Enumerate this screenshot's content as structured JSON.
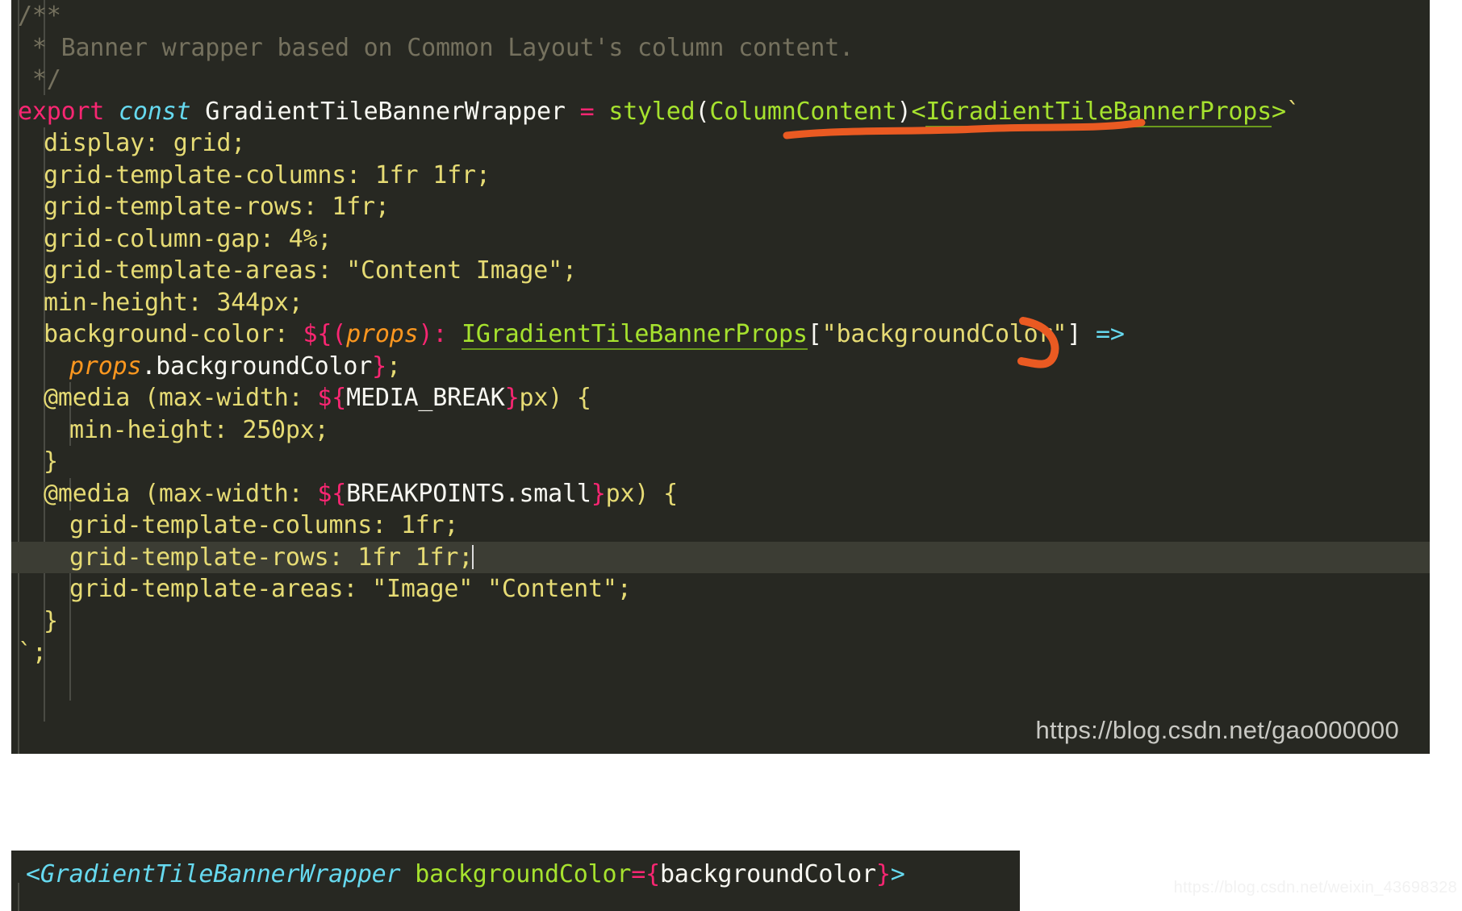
{
  "editor": {
    "theme_background": "#272822",
    "page_background": "#ffffff",
    "highlight_line_background": "#3c3d34",
    "main_block": {
      "lines": [
        {
          "n": 1,
          "indent": 0,
          "tokens": [
            {
              "c": "t-comment",
              "t": "/**"
            }
          ]
        },
        {
          "n": 2,
          "indent": 0,
          "tokens": [
            {
              "c": "t-comment",
              "t": " * Banner wrapper based on Common Layout's column content."
            }
          ]
        },
        {
          "n": 3,
          "indent": 0,
          "tokens": [
            {
              "c": "t-comment",
              "t": " */"
            }
          ]
        },
        {
          "n": 4,
          "indent": 0,
          "tokens": [
            {
              "c": "t-keyword",
              "t": "export "
            },
            {
              "c": "t-storage",
              "t": "const "
            },
            {
              "c": "t-plain",
              "t": "GradientTileBannerWrapper "
            },
            {
              "c": "t-keyword",
              "t": "= "
            },
            {
              "c": "t-func",
              "t": "styled"
            },
            {
              "c": "t-plain",
              "t": "("
            },
            {
              "c": "t-func",
              "t": "ColumnContent"
            },
            {
              "c": "t-plain",
              "t": ")"
            },
            {
              "c": "t-type",
              "t": "<"
            },
            {
              "c": "t-type-u",
              "t": "IGradientTileBannerProps"
            },
            {
              "c": "t-type",
              "t": ">"
            },
            {
              "c": "t-backtick",
              "t": "`"
            }
          ]
        },
        {
          "n": 5,
          "indent": 1,
          "tokens": [
            {
              "c": "t-css",
              "t": "display: grid;"
            }
          ]
        },
        {
          "n": 6,
          "indent": 1,
          "tokens": [
            {
              "c": "t-css",
              "t": "grid-template-columns: 1fr 1fr;"
            }
          ]
        },
        {
          "n": 7,
          "indent": 1,
          "tokens": [
            {
              "c": "t-css",
              "t": "grid-template-rows: 1fr;"
            }
          ]
        },
        {
          "n": 8,
          "indent": 1,
          "tokens": [
            {
              "c": "t-css",
              "t": "grid-column-gap: 4%;"
            }
          ]
        },
        {
          "n": 9,
          "indent": 1,
          "tokens": [
            {
              "c": "t-css",
              "t": "grid-template-areas: \"Content Image\";"
            }
          ]
        },
        {
          "n": 10,
          "indent": 1,
          "tokens": [
            {
              "c": "t-css",
              "t": "min-height: 344px;"
            }
          ]
        },
        {
          "n": 11,
          "indent": 1,
          "tokens": [
            {
              "c": "t-css",
              "t": "background-color: "
            },
            {
              "c": "t-keyword",
              "t": "${"
            },
            {
              "c": "t-brace",
              "t": "("
            },
            {
              "c": "t-param",
              "t": "props"
            },
            {
              "c": "t-brace",
              "t": ")"
            },
            {
              "c": "t-brace",
              "t": ": "
            },
            {
              "c": "t-type-u",
              "t": "IGradientTileBannerProps"
            },
            {
              "c": "t-white",
              "t": "["
            },
            {
              "c": "t-css",
              "t": "\"backgroundColor\""
            },
            {
              "c": "t-white",
              "t": "] "
            },
            {
              "c": "t-arrow",
              "t": "=>"
            }
          ]
        },
        {
          "n": 12,
          "indent": 2,
          "tokens": [
            {
              "c": "t-param",
              "t": "props"
            },
            {
              "c": "t-white",
              "t": ".backgroundColor"
            },
            {
              "c": "t-brace",
              "t": "}"
            },
            {
              "c": "t-css",
              "t": ";"
            }
          ]
        },
        {
          "n": 13,
          "indent": 1,
          "tokens": [
            {
              "c": "t-css",
              "t": "@media (max-width: "
            },
            {
              "c": "t-keyword",
              "t": "${"
            },
            {
              "c": "t-white",
              "t": "MEDIA_BREAK"
            },
            {
              "c": "t-keyword",
              "t": "}"
            },
            {
              "c": "t-css",
              "t": "px) {"
            }
          ]
        },
        {
          "n": 14,
          "indent": 2,
          "tokens": [
            {
              "c": "t-css",
              "t": "min-height: 250px;"
            }
          ]
        },
        {
          "n": 15,
          "indent": 1,
          "tokens": [
            {
              "c": "t-css",
              "t": "}"
            }
          ]
        },
        {
          "n": 16,
          "indent": 1,
          "tokens": [
            {
              "c": "t-css",
              "t": "@media (max-width: "
            },
            {
              "c": "t-keyword",
              "t": "${"
            },
            {
              "c": "t-white",
              "t": "BREAKPOINTS.small"
            },
            {
              "c": "t-keyword",
              "t": "}"
            },
            {
              "c": "t-css",
              "t": "px) {"
            }
          ]
        },
        {
          "n": 17,
          "indent": 2,
          "tokens": [
            {
              "c": "t-css",
              "t": "grid-template-columns: 1fr;"
            }
          ]
        },
        {
          "n": 18,
          "indent": 2,
          "highlighted": true,
          "caret": true,
          "tokens": [
            {
              "c": "t-css",
              "t": "grid-template-rows: 1fr 1fr;"
            }
          ]
        },
        {
          "n": 19,
          "indent": 2,
          "tokens": [
            {
              "c": "t-css",
              "t": "grid-template-areas: \"Image\" \"Content\";"
            }
          ]
        },
        {
          "n": 20,
          "indent": 1,
          "tokens": [
            {
              "c": "t-css",
              "t": "}"
            }
          ]
        },
        {
          "n": 21,
          "indent": 0,
          "tokens": [
            {
              "c": "t-backtick",
              "t": "`"
            },
            {
              "c": "t-css",
              "t": ";"
            }
          ]
        }
      ]
    },
    "secondary_block": {
      "lines": [
        {
          "n": 1,
          "indent": 0,
          "tokens": [
            {
              "c": "t-tag",
              "t": "<GradientTileBannerWrapper "
            },
            {
              "c": "t-attr",
              "t": "backgroundColor"
            },
            {
              "c": "t-brace",
              "t": "={"
            },
            {
              "c": "t-white",
              "t": "backgroundColor"
            },
            {
              "c": "t-brace",
              "t": "}"
            },
            {
              "c": "t-tag",
              "t": ">"
            }
          ]
        }
      ]
    }
  },
  "annotations": {
    "color": "#ea5a22",
    "marks": [
      {
        "name": "underline-igradienttilebannerprops",
        "type": "hand-underline"
      },
      {
        "name": "arrow-curve-after-fat-arrow",
        "type": "hand-curve"
      }
    ]
  },
  "watermarks": {
    "primary": "https://blog.csdn.net/gao000000",
    "secondary": "https://blog.csdn.net/weixin_43698328"
  }
}
